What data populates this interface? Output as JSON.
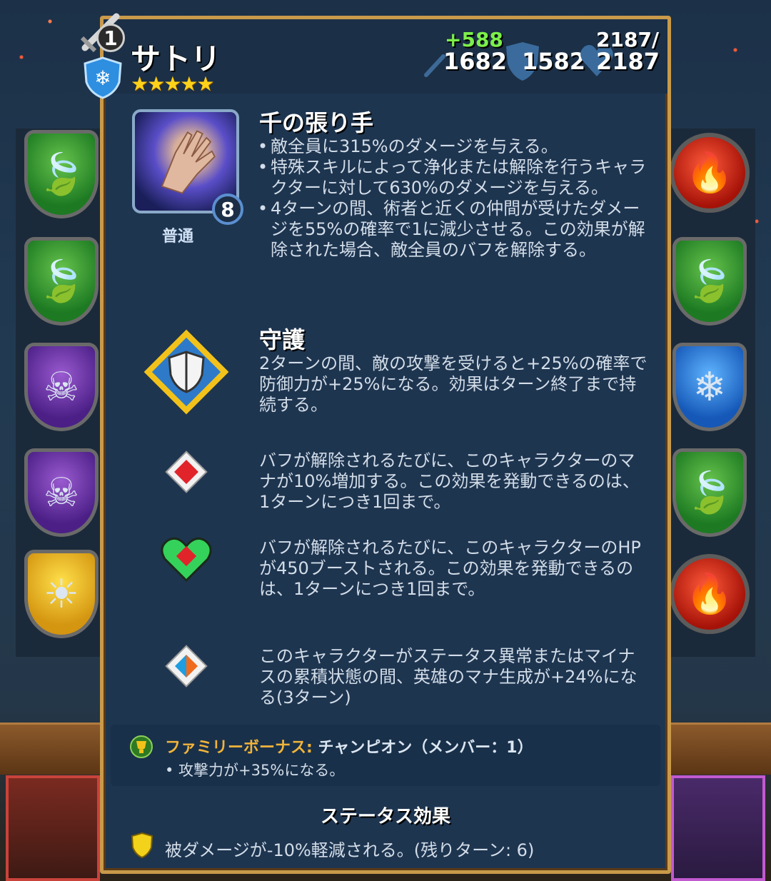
{
  "hero": {
    "name": "サトリ",
    "stars": "★★★★★",
    "level_badge": "1",
    "stats": {
      "attack_bonus": "+588",
      "attack": "1682",
      "defense": "1582",
      "hp_current": "2187/",
      "hp_max": "2187"
    }
  },
  "special": {
    "title": "千の張り手",
    "level": "8",
    "rarity": "普通",
    "line1": "敵全員に315%のダメージを与える。",
    "line2": "特殊スキルによって浄化または解除を行うキャラクターに対して630%のダメージを与える。",
    "line3": "4ターンの間、術者と近くの仲間が受けたダメージを55%の確率で1に減少させる。この効果が解除された場合、敵全員のバフを解除する。"
  },
  "passive1": {
    "title": "守護",
    "text": "2ターンの間、敵の攻撃を受けると+25%の確率で防御力が+25%になる。効果はターン終了まで持続する。"
  },
  "passive2": {
    "text": "バフが解除されるたびに、このキャラクターのマナが10%増加する。この効果を発動できるのは、1ターンにつき1回まで。"
  },
  "passive3": {
    "text": "バフが解除されるたびに、このキャラクターのHPが450ブーストされる。この効果を発動できるのは、1ターンにつき1回まで。"
  },
  "passive4": {
    "text": "このキャラクターがステータス異常またはマイナスの累積状態の間、英雄のマナ生成が+24%になる(3ターン)"
  },
  "family": {
    "label": "ファミリーボーナス:",
    "value": "チャンピオン（メンバー：1）",
    "bonus": "• 攻撃力が+35%になる。"
  },
  "status": {
    "title": "ステータス効果",
    "text": "被ダメージが-10%軽減される。(残りターン: 6)"
  },
  "colors": {
    "panel_border": "#c99a4a",
    "highlight": "#7fc3ff",
    "bonus_green": "#7cf04a",
    "family_gold": "#f1b43a"
  }
}
